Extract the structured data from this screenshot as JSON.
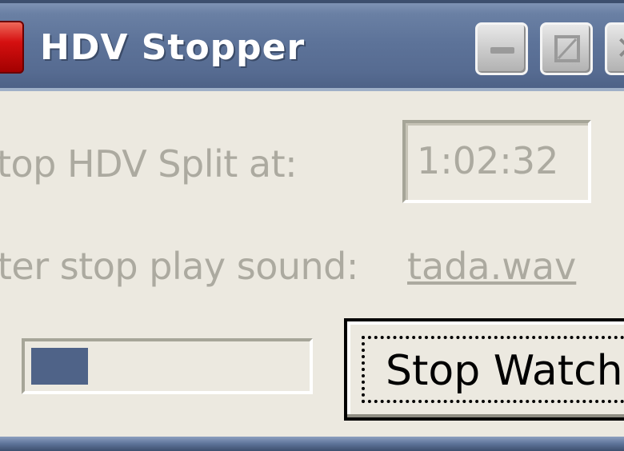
{
  "window": {
    "title": "HDV Stopper",
    "icons": {
      "app": "app-icon",
      "minimize": "minimize-icon",
      "maximize": "maximize-icon",
      "close": "close-icon"
    }
  },
  "form": {
    "stop_label": "top HDV Split at:",
    "stop_time": "1:02:32",
    "after_label": "fter stop play sound:",
    "sound_file": "tada.wav"
  },
  "progress": {
    "fraction": 0.21
  },
  "actions": {
    "stop_watch_label": "Stop Watch"
  },
  "colors": {
    "titlebar": "#5d7399",
    "progress_fill": "#4f6388",
    "disabled_text": "#acaaa0",
    "window_bg": "#ece9e0"
  }
}
